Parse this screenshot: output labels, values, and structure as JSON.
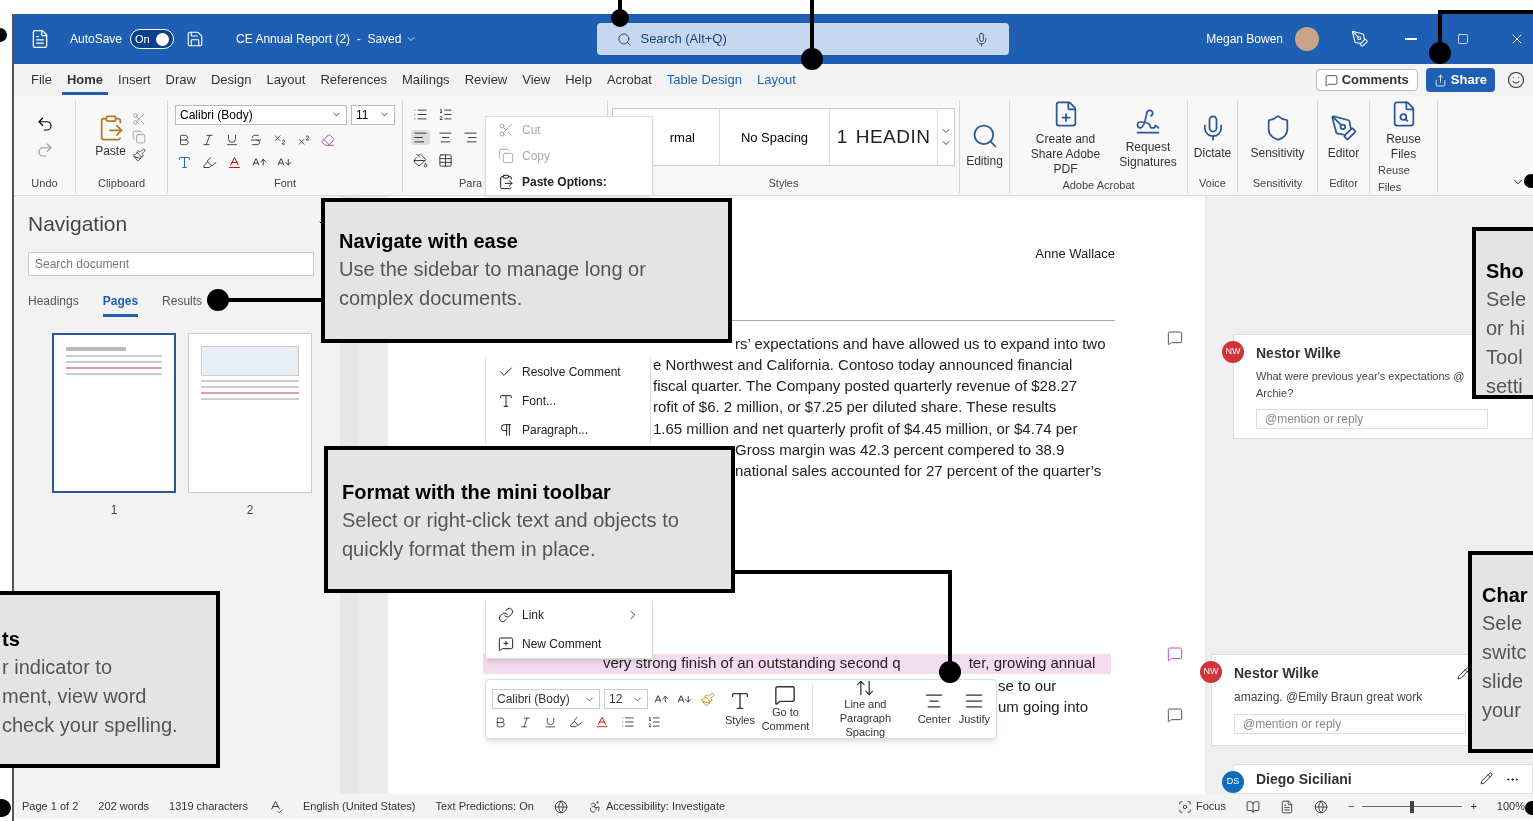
{
  "title_bar": {
    "autosave_label": "AutoSave",
    "autosave_state": "On",
    "autosave_on": true,
    "document_title": "CE Annual Report (2)  -  Saved",
    "search_placeholder": "Search (Alt+Q)",
    "user_name": "Megan Bowen"
  },
  "menu_tabs": [
    {
      "label": "File",
      "selected": false,
      "kind": "normal"
    },
    {
      "label": "Home",
      "selected": true,
      "kind": "normal"
    },
    {
      "label": "Insert",
      "selected": false,
      "kind": "normal"
    },
    {
      "label": "Draw",
      "selected": false,
      "kind": "normal"
    },
    {
      "label": "Design",
      "selected": false,
      "kind": "normal"
    },
    {
      "label": "Layout",
      "selected": false,
      "kind": "normal"
    },
    {
      "label": "References",
      "selected": false,
      "kind": "normal"
    },
    {
      "label": "Mailings",
      "selected": false,
      "kind": "normal"
    },
    {
      "label": "Review",
      "selected": false,
      "kind": "normal"
    },
    {
      "label": "View",
      "selected": false,
      "kind": "normal"
    },
    {
      "label": "Help",
      "selected": false,
      "kind": "normal"
    },
    {
      "label": "Acrobat",
      "selected": false,
      "kind": "normal"
    },
    {
      "label": "Table Design",
      "selected": false,
      "kind": "contextual"
    },
    {
      "label": "Layout",
      "selected": false,
      "kind": "contextual"
    }
  ],
  "comments_button": "Comments",
  "share_button": "Share",
  "ribbon": {
    "undo_label": "Undo",
    "paste": "Paste",
    "clipboard_label": "Clipboard",
    "font_name": "Calibri (Body)",
    "font_size": "11",
    "font_label": "Font",
    "paragraph_label": "Para",
    "styles": [
      {
        "label": "rmal",
        "kind": "normal"
      },
      {
        "label": "No Spacing",
        "kind": "normal"
      },
      {
        "number": "1",
        "label": "HEADIN",
        "kind": "heading"
      }
    ],
    "styles_label": "Styles",
    "editing": "Editing",
    "acrobat_buttons": [
      "Create and Share Adobe PDF",
      "Request Signatures"
    ],
    "acrobat_label": "Adobe Acrobat",
    "dictate": "Dictate",
    "voice_label": "Voice",
    "sensitivity": "Sensitivity",
    "sensitivity_label": "Sensitivity",
    "editor": "Editor",
    "editor_label": "Editor",
    "reuse": "Reuse Files",
    "reuse_label": "Reuse Files"
  },
  "context_menu": {
    "top": [
      {
        "label": "Cut",
        "kind": "cut",
        "disabled": true
      },
      {
        "label": "Copy",
        "kind": "copy",
        "disabled": true
      },
      {
        "label": "Paste Options:",
        "kind": "header",
        "disabled": false
      }
    ],
    "middle": [
      {
        "label": "Resolve Comment",
        "kind": "resolve"
      },
      {
        "label": "Font...",
        "kind": "font"
      },
      {
        "label": "Paragraph...",
        "kind": "paragraph"
      }
    ],
    "bottom": [
      {
        "label": "Link",
        "kind": "link",
        "submenu": true
      },
      {
        "label": "New Comment",
        "kind": "comment",
        "submenu": false
      }
    ]
  },
  "navigation": {
    "title": "Navigation",
    "search_placeholder": "Search document",
    "tabs": [
      {
        "label": "Headings",
        "selected": false
      },
      {
        "label": "Pages",
        "selected": true
      },
      {
        "label": "Results",
        "selected": false
      }
    ],
    "pages": [
      {
        "number": "1",
        "selected": true,
        "kind": "text"
      },
      {
        "number": "2",
        "selected": false,
        "kind": "chart"
      }
    ]
  },
  "document": {
    "author": "Anne Wallace",
    "lines": [
      "rs’ expectations and have allowed us to expand into two",
      "e Northwest and California.  Contoso today announced financial",
      "fiscal quarter. The Company posted quarterly revenue of $28.27",
      "rofit of $6. 2 million, or $7.25 per diluted share. These results",
      "1.65 million and net quarterly profit of $4.45 million, or $4.74 per",
      "Gross margin was 42.3 percent compered to 38.9",
      "national sales accounted for 27 percent of the quarter’s"
    ],
    "highlight_line": [
      "very strong finish of an outstanding second q",
      "ter, growing annual"
    ],
    "lower_lines": [
      "se to our",
      "um going into"
    ]
  },
  "comment_markers": [
    {
      "active": false
    },
    {
      "active": true
    },
    {
      "active": false
    }
  ],
  "comments": [
    {
      "initials": "NW",
      "author": "Nestor Wilke",
      "body": "What were previous year's expectations @ Archie?",
      "reply_placeholder": "@mention or reply",
      "color": "#d13438"
    },
    {
      "initials": "NW",
      "author": "Nestor Wilke",
      "body": "amazing. @Emily Braun great work",
      "reply_placeholder": "@mention or reply",
      "color": "#d13438"
    },
    {
      "initials": "DS",
      "author": "Diego Siciliani",
      "color": "#0f6cbd"
    }
  ],
  "mini_toolbar": {
    "font_name": "Calibri (Body)",
    "font_size": "12",
    "styles": "Styles",
    "go_to_comment": "Go to Comment",
    "spacing": "Line and Paragraph Spacing",
    "center": "Center",
    "justify": "Justify"
  },
  "status_bar": {
    "page": "Page 1 of 2",
    "words": "202 words",
    "characters": "1319 characters",
    "language": "English (United States)",
    "predictions": "Text Predictions: On",
    "accessibility": "Accessibility: Investigate",
    "focus": "Focus",
    "zoom_out": "−",
    "zoom_in": "+",
    "zoom": "100%",
    "zoom_level": {
      "level": 0.5
    }
  },
  "callouts": [
    {
      "title": "Navigate with ease",
      "lines": [
        "Use the sidebar to manage long or",
        "complex documents."
      ]
    },
    {
      "title": "Format with the mini toolbar",
      "lines": [
        "Select or right-click text and objects to",
        "quickly format them in place."
      ]
    },
    {
      "title": "ts",
      "lines": [
        "r indicator to",
        "ment, view word",
        "check your spelling."
      ]
    },
    {
      "title": "Sho",
      "lines": [
        "Sele",
        "or hi",
        "Tool",
        "setti"
      ]
    },
    {
      "title": "Char",
      "lines": [
        "Sele",
        "switc",
        "slide",
        "your"
      ]
    }
  ]
}
